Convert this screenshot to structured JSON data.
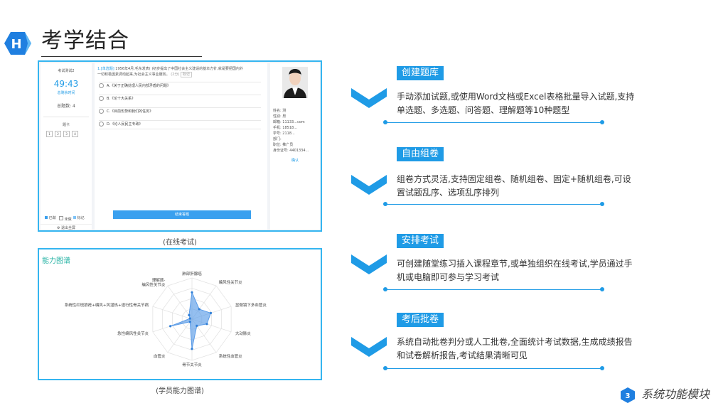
{
  "header": {
    "logo_letter": "H",
    "title": "考学结合"
  },
  "exam": {
    "panel_title": "考试测试2",
    "timer": "49:43",
    "time_label": "总剩余时间",
    "total_label": "总题数: 4",
    "section_label": "题卡",
    "question_numbers": [
      "1",
      "2",
      "3",
      "4"
    ],
    "legend": [
      "已做",
      "未做",
      "标记"
    ],
    "exit_label": "退出全屏",
    "question_tag": "1.[单选题]",
    "question_text_1": "1956年4月,毛东发表(  )初步提出了中国社会主义建设的基本方针,就是要把国内外",
    "question_text_2": "一切积极因素调动起来,为社会主义事业服务。",
    "question_score": "(2分)",
    "question_mark": "标记",
    "options": [
      "A.《关于正确处理人民内部矛盾的问题》",
      "B.《论十大关系》",
      "C.《目前形势和我们的任务》",
      "D.《论人民民主专政》"
    ],
    "submit_label": "结束答题",
    "profile_rows": [
      "姓名: 测",
      "性别: 男",
      "邮箱: 11133...com",
      "手机: 18518...",
      "学号: 2118...",
      "部门:",
      "职位: 推广员",
      "身份证号: 4401334..."
    ],
    "profile_link": "确认"
  },
  "captions": {
    "exam": "(在线考试)",
    "radar": "(学员能力图谱)"
  },
  "radar": {
    "title": "能力图谱",
    "labels": [
      "肺部肝腺癌",
      "编风性关节炎",
      "显微镜下多血管炎",
      "大动脉炎",
      "系统性血管炎",
      "骨节关节炎",
      "血管炎",
      "急性编风性关节炎",
      "系统性红斑狼疮+编风+风湿热+退行性骨关节病",
      "理解题-编风性关节炎"
    ],
    "values": [
      0.65,
      0.3,
      0.48,
      0.38,
      0.2,
      0.72,
      0.08,
      0.55,
      0.05,
      0.12
    ]
  },
  "sections": [
    {
      "title": "创建题库",
      "text_1": "手动添加试题,或使用Word文档或Excel表格批量导入试题,支持",
      "text_2": "单选题、多选题、问答题、理解题等10种题型"
    },
    {
      "title": "自由组卷",
      "text_1": "组卷方式灵活,支持固定组卷、随机组卷、固定+随机组卷,可设",
      "text_2": "置试题乱序、选项乱序排列"
    },
    {
      "title": "安排考试",
      "text_1": "可创建随堂练习插入课程章节,或单独组织在线考试,学员通过手",
      "text_2": "机或电脑即可参与学习考试"
    },
    {
      "title": "考后批卷",
      "text_1": "系统自动批卷判分或人工批卷,全面统计考试数据,生成成绩报告",
      "text_2": "和试卷解析报告,考试结果清晰可见"
    }
  ],
  "footer": {
    "page_number": "3",
    "title": "系统功能模块"
  },
  "colors": {
    "accent": "#1f9be6",
    "frame": "#35b5f0",
    "radar_fill": "#5b9ce8",
    "radar_title": "#2ab4a6"
  }
}
